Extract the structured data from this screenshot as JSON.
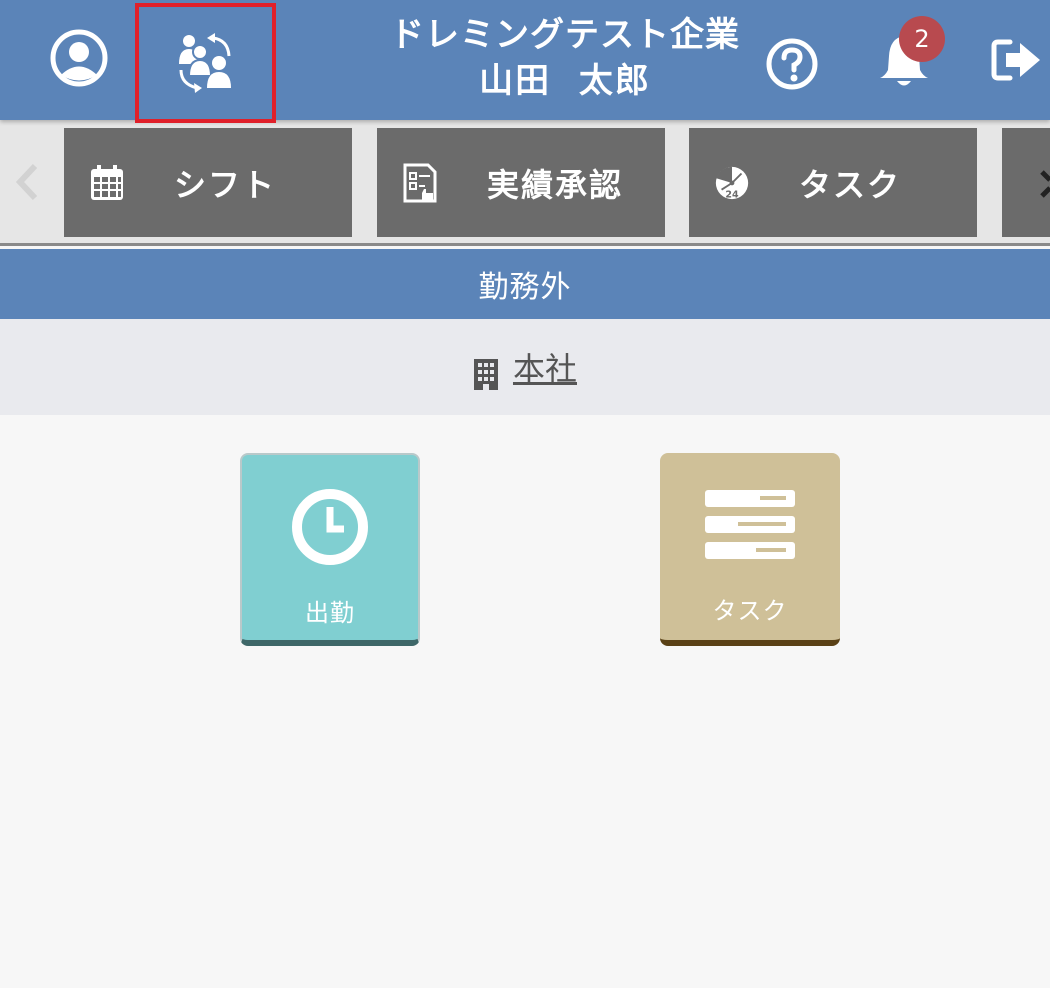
{
  "header": {
    "company_name": "ドレミングテスト企業",
    "user_name": "山田  太郎",
    "notification_count": "2",
    "icons": {
      "profile": "user-circle-icon",
      "switch_user": "switch-users-icon",
      "help": "question-circle-icon",
      "notifications": "bell-icon",
      "logout": "sign-out-icon"
    }
  },
  "menu": {
    "items": [
      {
        "label": "シフト",
        "icon": "calendar-icon"
      },
      {
        "label": "実績承認",
        "icon": "approval-sheet-icon"
      },
      {
        "label": "タスク",
        "icon": "clock-24-icon"
      }
    ]
  },
  "status": {
    "label": "勤務外"
  },
  "office": {
    "name": "本社",
    "icon": "building-icon"
  },
  "actions": {
    "clock_in": {
      "label": "出勤",
      "icon": "clock-icon"
    },
    "task": {
      "label": "タスク",
      "icon": "task-list-icon"
    }
  },
  "colors": {
    "header_bg": "#5b84b8",
    "menu_tile_bg": "#6b6b6b",
    "clock_tile_bg": "#80cfd1",
    "task_tile_bg": "#cfc098",
    "badge_bg": "#b84a4f",
    "highlight_border": "#e0202a"
  }
}
